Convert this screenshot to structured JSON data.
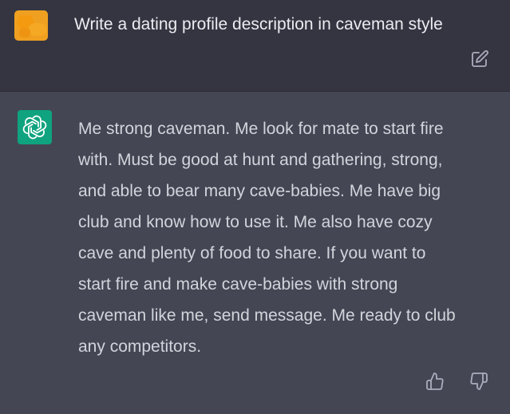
{
  "user_message": {
    "avatar_icon": "user-avatar-icon",
    "avatar_color": "#f0a020",
    "text": "Write a dating profile description in caveman style",
    "edit_icon": "edit-icon"
  },
  "assistant_message": {
    "avatar_icon": "openai-logo-icon",
    "avatar_color": "#10a37f",
    "lines": [
      "Me strong caveman. Me look for mate to start fire",
      "with. Must be good at hunt and gathering, strong,",
      "and able to bear many cave-babies. Me have big",
      "club and know how to use it. Me also have cozy",
      "cave and plenty of food to share. If you want to",
      "start fire and make cave-babies with strong",
      "caveman like me, send message. Me ready to club",
      "any competitors."
    ],
    "feedback_icons": [
      "thumbs-up-icon",
      "thumbs-down-icon"
    ]
  },
  "colors": {
    "user_bg": "#343541",
    "assistant_bg": "#444654",
    "text_primary": "#ececf1",
    "text_reply": "#d1d5db",
    "icon_color": "#acacbe"
  }
}
